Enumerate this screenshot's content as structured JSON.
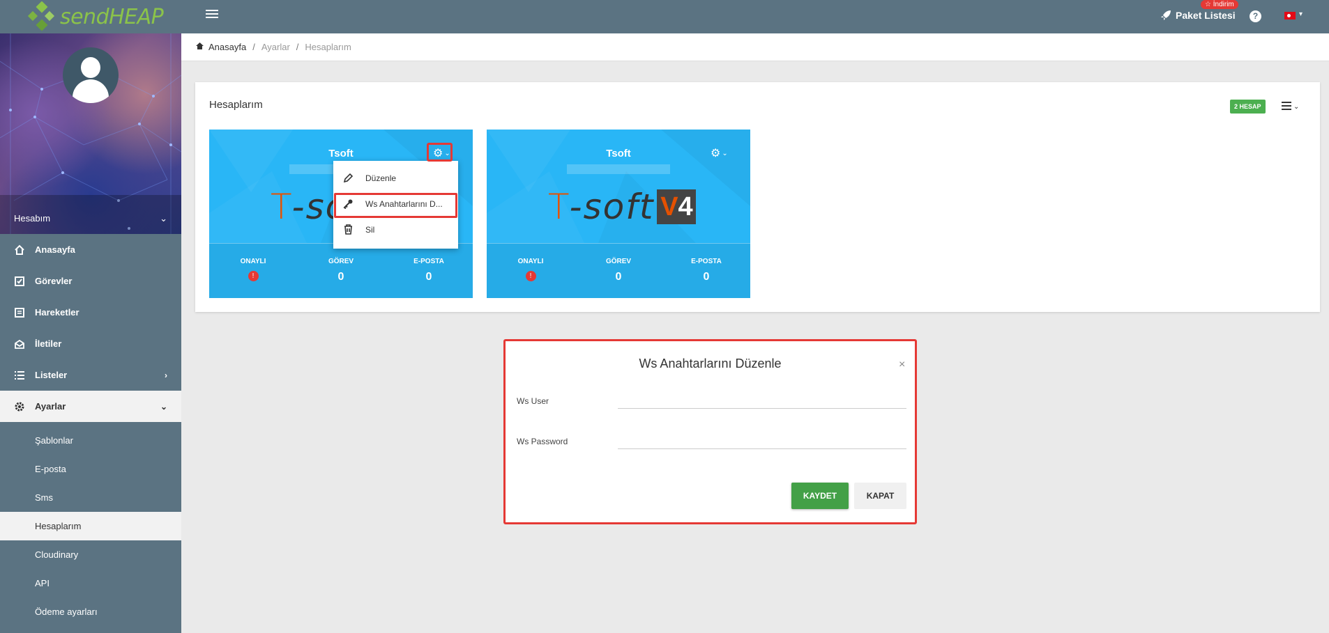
{
  "app": {
    "logo_text": "sendHEAP"
  },
  "header": {
    "paket_label": "Paket Listesi",
    "indirim_badge": "☆ İndirim",
    "help": "?"
  },
  "sidebar": {
    "account_label": "Hesabım",
    "nav": [
      {
        "label": "Anasayfa",
        "icon": "home-icon"
      },
      {
        "label": "Görevler",
        "icon": "checkbox-icon"
      },
      {
        "label": "Hareketler",
        "icon": "list-alt-icon"
      },
      {
        "label": "İletiler",
        "icon": "mail-open-icon"
      },
      {
        "label": "Listeler",
        "icon": "list-icon"
      },
      {
        "label": "Ayarlar",
        "icon": "gear-icon"
      }
    ],
    "subnav": [
      "Şablonlar",
      "E-posta",
      "Sms",
      "Hesaplarım",
      "Cloudinary",
      "API",
      "Ödeme ayarları"
    ]
  },
  "breadcrumb": {
    "home": "Anasayfa",
    "level2": "Ayarlar",
    "current": "Hesaplarım",
    "sep": "/"
  },
  "card": {
    "title": "Hesaplarım",
    "badge": "2 HESAP"
  },
  "accounts": [
    {
      "name": "Tsoft",
      "stats": {
        "onayli_label": "ONAYLI",
        "gorev_label": "GÖREV",
        "gorev_value": "0",
        "eposta_label": "E-POSTA",
        "eposta_value": "0"
      }
    },
    {
      "name": "Tsoft",
      "stats": {
        "onayli_label": "ONAYLI",
        "gorev_label": "GÖREV",
        "gorev_value": "0",
        "eposta_label": "E-POSTA",
        "eposta_value": "0"
      }
    }
  ],
  "logo": {
    "t": "T",
    "soft": "-soft",
    "v": "V",
    "four": "4"
  },
  "dropdown": {
    "items": [
      "Düzenle",
      "Ws Anahtarlarını D...",
      "Sil"
    ]
  },
  "modal": {
    "title": "Ws Anahtarlarını Düzenle",
    "close": "×",
    "ws_user_label": "Ws User",
    "ws_user_value": "",
    "ws_password_label": "Ws Password",
    "ws_password_value": "",
    "save_label": "KAYDET",
    "close_label": "KAPAT"
  },
  "colors": {
    "topbar": "#5b7382",
    "accent_red": "#e53935",
    "account_card": "#29b6f6",
    "save_green": "#43a047",
    "badge_green": "#4caf50"
  }
}
